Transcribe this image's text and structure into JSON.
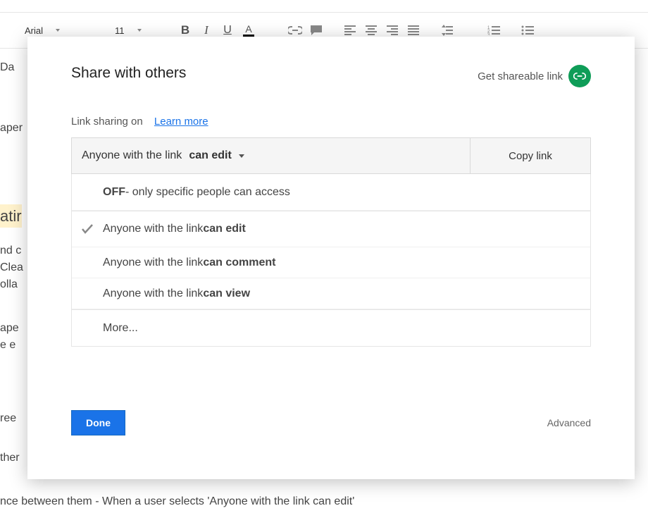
{
  "toolbar": {
    "font": "Arial",
    "size": "11"
  },
  "doc": {
    "line_aper": "aper",
    "line_atir": "atir",
    "line_nd_c": "nd c",
    "line_clea": "Clea",
    "line_olla": "olla",
    "line_ape": "ape",
    "line_e_e": "e e",
    "line_ree": "ree",
    "line_ther": "ther",
    "line_bottom": "nce between them - When a user selects 'Anyone with the link can edit'",
    "line_da_top": "Da"
  },
  "dialog": {
    "title": "Share with others",
    "get_link": "Get shareable link",
    "link_sharing": "Link sharing on",
    "learn_more": "Learn more",
    "dropdown_prefix": "Anyone with the link ",
    "dropdown_bold": "can edit",
    "copy_link": "Copy link",
    "options": {
      "off_bold": "OFF",
      "off_rest": " - only specific people can access",
      "edit_prefix": "Anyone with the link ",
      "edit_bold": "can edit",
      "comment_prefix": "Anyone with the link ",
      "comment_bold": "can comment",
      "view_prefix": "Anyone with the link ",
      "view_bold": "can view",
      "more": "More..."
    },
    "done": "Done",
    "advanced": "Advanced"
  }
}
